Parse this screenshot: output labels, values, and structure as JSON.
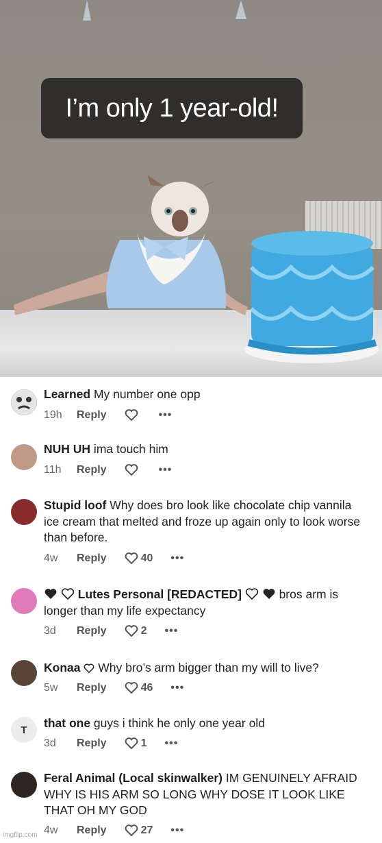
{
  "caption": "I’m only 1 year-old!",
  "comments": [
    {
      "user": "Learned",
      "text": " My number one opp",
      "time": "19h",
      "reply": "Reply",
      "likes": ""
    },
    {
      "user": "NUH UH",
      "text": " ima touch him",
      "time": "11h",
      "reply": "Reply",
      "likes": ""
    },
    {
      "user": "Stupid loof",
      "text": " Why does bro look like chocolate chip vannila ice cream that melted and froze up again only to look worse than before.",
      "time": "4w",
      "reply": "Reply",
      "likes": "40"
    },
    {
      "user": "Lutes Personal [REDACTED]",
      "text": " bros arm is longer than my life expectancy",
      "time": "3d",
      "reply": "Reply",
      "likes": "2"
    },
    {
      "user": "Konaa",
      "text": " Why bro’s arm bigger than my will to live?",
      "time": "5w",
      "reply": "Reply",
      "likes": "46"
    },
    {
      "user": "that one",
      "text": " guys i think he only one year old",
      "time": "3d",
      "reply": "Reply",
      "likes": "1",
      "avatar_letter": "T"
    },
    {
      "user": "Feral Animal (Local skinwalker)",
      "text": " IM GENUINELY AFRAID WHY IS HIS ARM SO LONG WHY DOSE IT LOOK LIKE THAT OH MY GOD",
      "time": "4w",
      "reply": "Reply",
      "likes": "27"
    }
  ],
  "more": "•••",
  "watermark": "imgflip.com",
  "colors": {
    "cake": "#3fa9e0",
    "costume": "#a9c9ea"
  }
}
